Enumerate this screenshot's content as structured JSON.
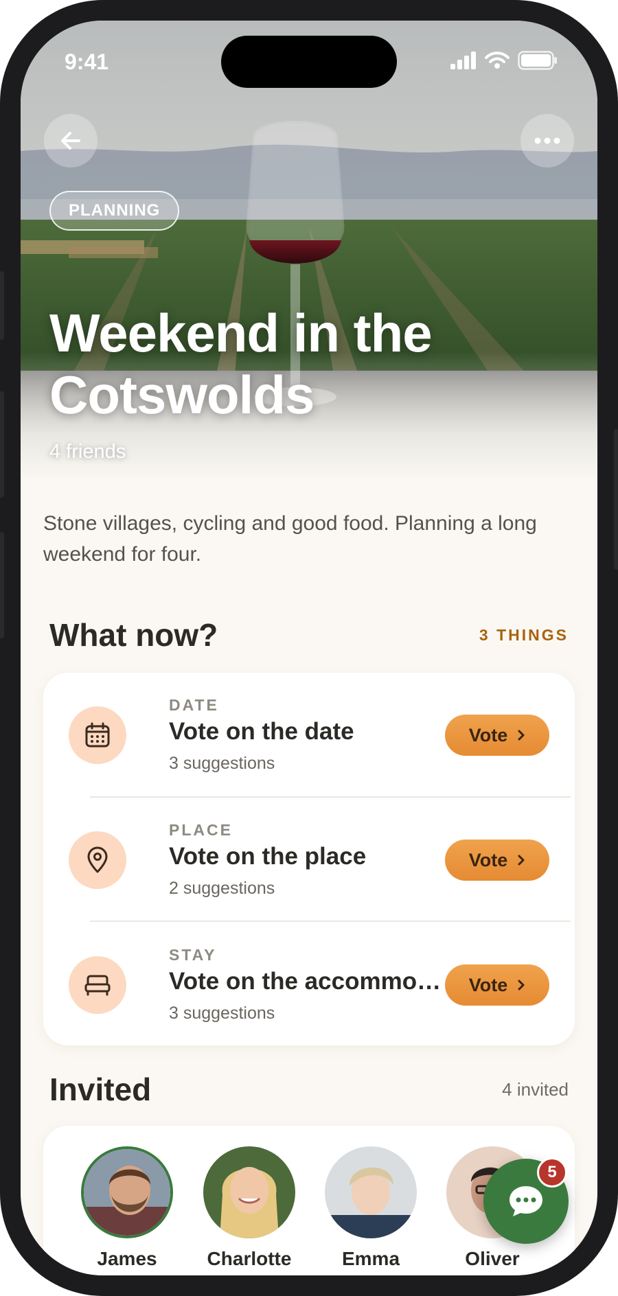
{
  "status_bar": {
    "time": "9:41"
  },
  "hero": {
    "badge": "PLANNING",
    "title": "Weekend in the Cotswolds",
    "subtitle": "4 friends"
  },
  "description": "Stone villages, cycling and good food. Planning a long weekend for four.",
  "tasks_section": {
    "title": "What now?",
    "count": "3 THINGS",
    "items": [
      {
        "category": "DATE",
        "title": "Vote on the date",
        "sub": "3 suggestions",
        "button": "Vote",
        "icon": "calendar-icon"
      },
      {
        "category": "PLACE",
        "title": "Vote on the place",
        "sub": "2 suggestions",
        "button": "Vote",
        "icon": "location-pin-icon"
      },
      {
        "category": "STAY",
        "title": "Vote on the accommodation",
        "sub": "3 suggestions",
        "button": "Vote",
        "icon": "bed-icon"
      }
    ]
  },
  "invited_section": {
    "title": "Invited",
    "count": "4 invited",
    "people": [
      {
        "name": "James"
      },
      {
        "name": "Charlotte"
      },
      {
        "name": "Emma"
      },
      {
        "name": "Oliver"
      }
    ]
  },
  "chat": {
    "unread": "5",
    "icon": "chat-bubble-icon"
  },
  "colors": {
    "accent": "#e58b33",
    "background": "#fbf8f3",
    "fab": "#3a7a3e",
    "badge": "#b8352c"
  }
}
